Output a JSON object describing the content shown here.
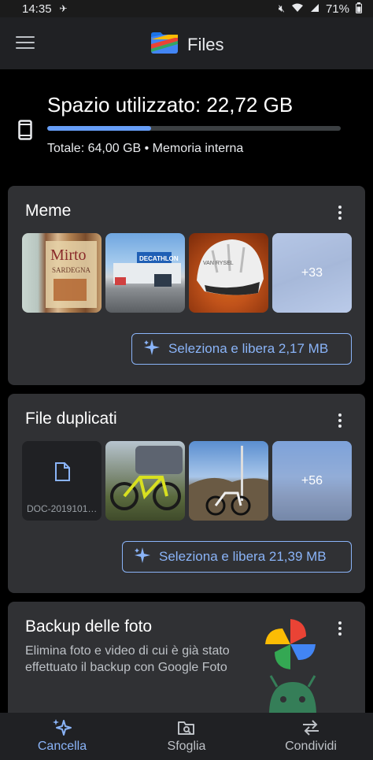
{
  "status_bar": {
    "time": "14:35",
    "battery": "71%"
  },
  "app": {
    "title": "Files"
  },
  "storage": {
    "title": "Spazio utilizzato: 22,72 GB",
    "subtitle": "Totale: 64,00 GB • Memoria interna",
    "used_fraction": 0.355
  },
  "cards": {
    "meme": {
      "title": "Meme",
      "more_count": "+33",
      "action_label": "Seleziona e libera 2,17 MB"
    },
    "duplicates": {
      "title": "File duplicati",
      "doc_name": "DOC-2019101…",
      "more_count": "+56",
      "action_label": "Seleziona e libera 21,39 MB"
    },
    "backup": {
      "title": "Backup delle foto",
      "text": "Elimina foto e video di cui è già stato effettuato il backup con Google Foto"
    }
  },
  "watermark": "TUTTOANDROID",
  "bottom_nav": {
    "items": [
      {
        "label": "Cancella",
        "icon": "sparkle-icon",
        "active": true
      },
      {
        "label": "Sfoglia",
        "icon": "browse-icon",
        "active": false
      },
      {
        "label": "Condividi",
        "icon": "share-icon",
        "active": false
      }
    ]
  },
  "colors": {
    "accent": "#8ab4f8",
    "bar_fill": "#669df6",
    "card": "#303134",
    "appbar": "#202124"
  }
}
